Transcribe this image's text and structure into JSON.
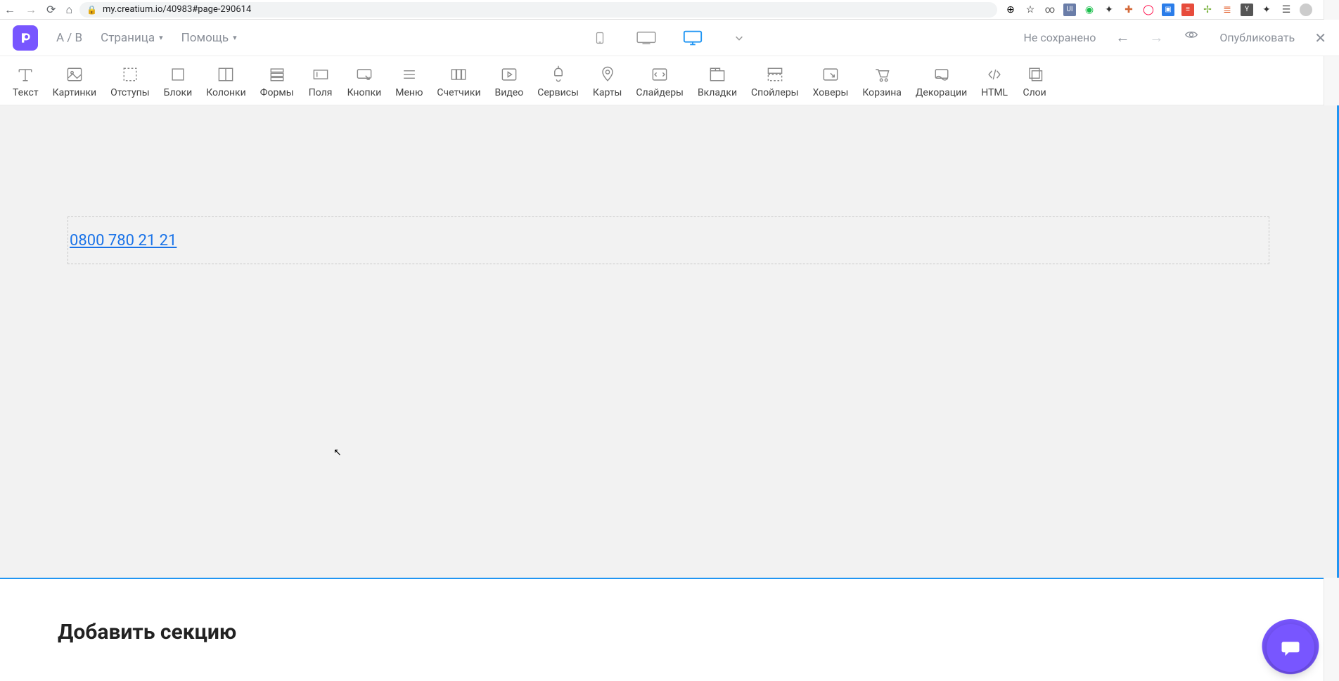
{
  "browser": {
    "url": "my.creatium.io/40983#page-290614"
  },
  "header": {
    "ab": "A / B",
    "page": "Страница",
    "help": "Помощь",
    "unsaved": "Не сохранено",
    "publish": "Опубликовать"
  },
  "tools": {
    "text": "Текст",
    "images": "Картинки",
    "spacing": "Отступы",
    "blocks": "Блоки",
    "columns": "Колонки",
    "forms": "Формы",
    "fields": "Поля",
    "buttons": "Кнопки",
    "menu": "Меню",
    "counters": "Счетчики",
    "video": "Видео",
    "services": "Сервисы",
    "maps": "Карты",
    "sliders": "Слайдеры",
    "tabs": "Вкладки",
    "spoilers": "Спойлеры",
    "hovers": "Ховеры",
    "cart": "Корзина",
    "decor": "Декорации",
    "html": "HTML",
    "layers": "Слои"
  },
  "canvas": {
    "phone": "0800 780 21 21"
  },
  "footer": {
    "add_section": "Добавить секцию"
  }
}
